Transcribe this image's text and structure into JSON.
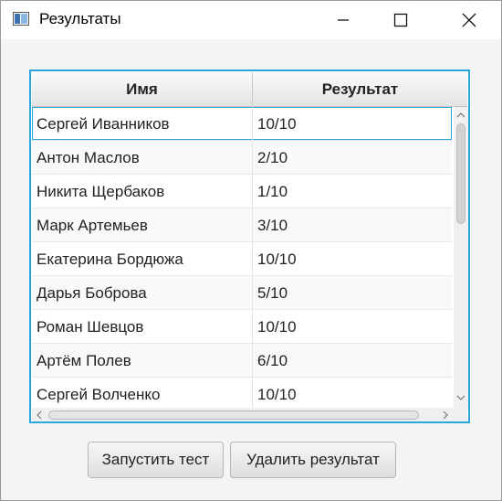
{
  "window": {
    "title": "Результаты"
  },
  "table": {
    "columns": [
      "Имя",
      "Результат"
    ],
    "rows": [
      {
        "name": "Сергей Иванников",
        "result": "10/10"
      },
      {
        "name": "Антон Маслов",
        "result": "2/10"
      },
      {
        "name": "Никита Щербаков",
        "result": "1/10"
      },
      {
        "name": "Марк Артемьев",
        "result": "3/10"
      },
      {
        "name": "Екатерина Бордюжа",
        "result": "10/10"
      },
      {
        "name": "Дарья Боброва",
        "result": "5/10"
      },
      {
        "name": "Роман Шевцов",
        "result": "10/10"
      },
      {
        "name": "Артём Полев",
        "result": "6/10"
      },
      {
        "name": "Сергей Волченко",
        "result": "10/10"
      }
    ]
  },
  "buttons": {
    "run_test": "Запустить тест",
    "delete_result": "Удалить результат"
  },
  "colors": {
    "focus_border": "#2aa6dd",
    "window_bg": "#f4f4f4"
  },
  "icons": {
    "app": "app-window-icon",
    "minimize": "minimize-icon",
    "maximize": "maximize-icon",
    "close": "close-icon"
  }
}
